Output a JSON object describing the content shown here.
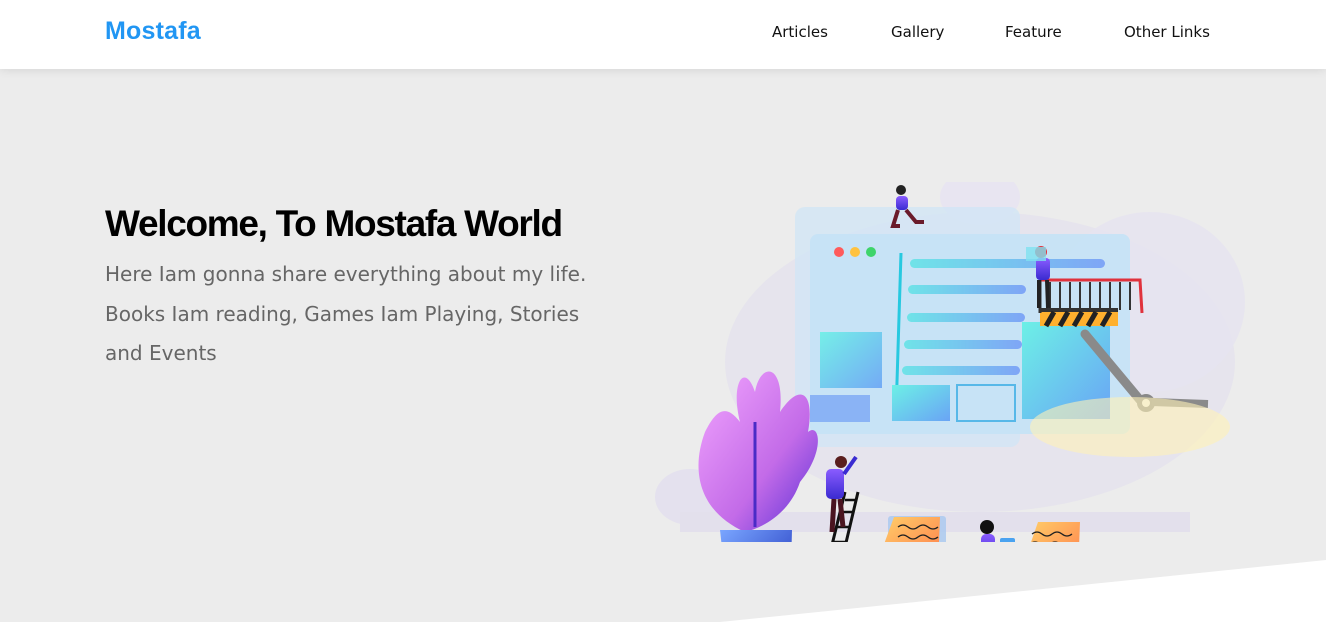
{
  "header": {
    "logo": "Mostafa",
    "nav": [
      {
        "label": "Articles"
      },
      {
        "label": "Gallery"
      },
      {
        "label": "Feature"
      },
      {
        "label": "Other Links"
      }
    ]
  },
  "landing": {
    "title": "Welcome, To Mostafa World",
    "intro": "Here Iam gonna share everything about my life. Books Iam reading, Games Iam Playing, Stories and Events"
  },
  "colors": {
    "brand": "#2196f3",
    "landing_bg": "#ececec",
    "text_muted": "#666666"
  }
}
